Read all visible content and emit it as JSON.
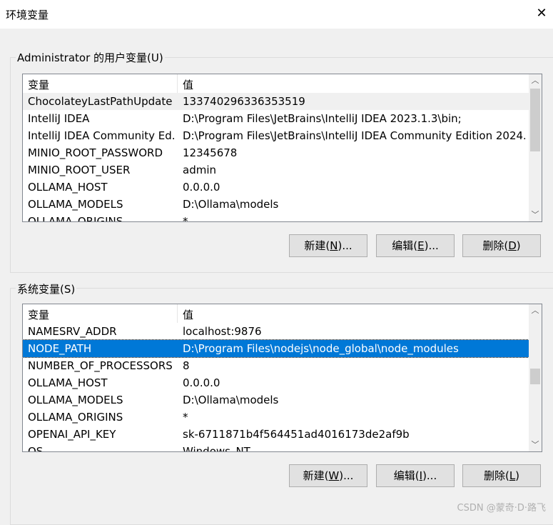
{
  "window": {
    "title": "环境变量",
    "close_glyph": "✕"
  },
  "user_vars": {
    "label": "Administrator 的用户变量(U)",
    "col_name": "变量",
    "col_value": "值",
    "rows": [
      {
        "name": "ChocolateyLastPathUpdate",
        "value": "133740296336353519"
      },
      {
        "name": "IntelliJ IDEA",
        "value": "D:\\Program Files\\JetBrains\\IntelliJ IDEA 2023.1.3\\bin;"
      },
      {
        "name": "IntelliJ IDEA Community Ed...",
        "value": "D:\\Program Files\\JetBrains\\IntelliJ IDEA Community Edition 2024..."
      },
      {
        "name": "MINIO_ROOT_PASSWORD",
        "value": "12345678"
      },
      {
        "name": "MINIO_ROOT_USER",
        "value": "admin"
      },
      {
        "name": "OLLAMA_HOST",
        "value": "0.0.0.0"
      },
      {
        "name": "OLLAMA_MODELS",
        "value": "D:\\Ollama\\models"
      },
      {
        "name": "OLLAMA_ORIGINS",
        "value": "*"
      }
    ],
    "buttons": {
      "new": {
        "pre": "新建(",
        "acc": "N",
        "post": ")..."
      },
      "edit": {
        "pre": "编辑(",
        "acc": "E",
        "post": ")..."
      },
      "delete": {
        "pre": "删除(",
        "acc": "D",
        "post": ")"
      }
    }
  },
  "system_vars": {
    "label": "系统变量(S)",
    "col_name": "变量",
    "col_value": "值",
    "rows": [
      {
        "name": "NAMESRV_ADDR",
        "value": "localhost:9876"
      },
      {
        "name": "NODE_PATH",
        "value": "D:\\Program Files\\nodejs\\node_global\\node_modules"
      },
      {
        "name": "NUMBER_OF_PROCESSORS",
        "value": "8"
      },
      {
        "name": "OLLAMA_HOST",
        "value": "0.0.0.0"
      },
      {
        "name": "OLLAMA_MODELS",
        "value": " D:\\Ollama\\models"
      },
      {
        "name": "OLLAMA_ORIGINS",
        "value": "*"
      },
      {
        "name": "OPENAI_API_KEY",
        "value": "sk-6711871b4f564451ad4016173de2af9b"
      },
      {
        "name": "OS",
        "value": "Windows_NT"
      }
    ],
    "buttons": {
      "new": {
        "pre": "新建(",
        "acc": "W",
        "post": ")..."
      },
      "edit": {
        "pre": "编辑(",
        "acc": "I",
        "post": ")..."
      },
      "delete": {
        "pre": "删除(",
        "acc": "L",
        "post": ")"
      }
    }
  },
  "icons": {
    "scroll_up": "chevron-up-icon",
    "scroll_down": "chevron-down-icon",
    "close": "close-icon"
  },
  "watermark": "CSDN @蒙奇·D·路飞"
}
